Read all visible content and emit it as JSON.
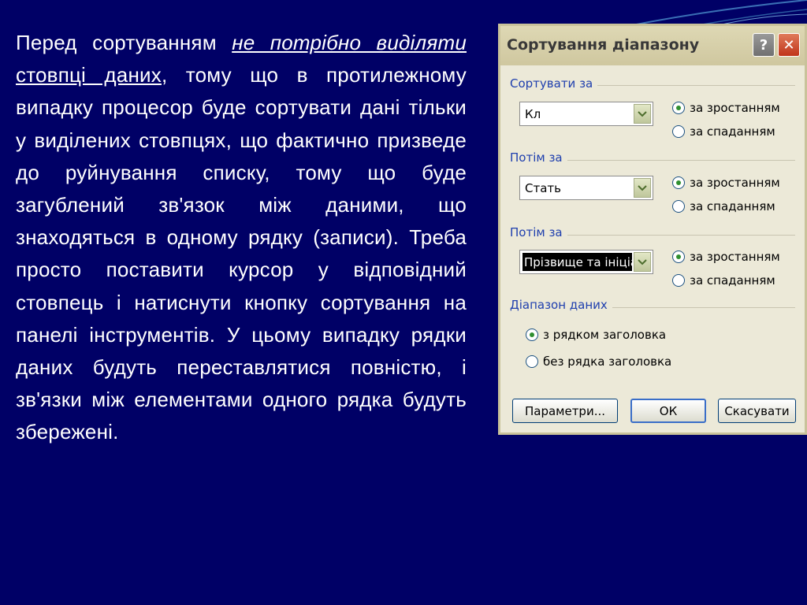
{
  "slide": {
    "text_plain_1": "Перед сортуванням ",
    "text_em": "не потрібно виділяти ",
    "text_ul": "стовпці даних",
    "text_plain_2": ", тому що в протилежному випадку процесор буде сортувати дані тільки у виділених стовпцях, що фактично призведе до руйнування списку, тому що буде загублений зв'язок між даними, що знаходяться в одному рядку (записи). Треба просто поставити курсор у відповідний стовпець і натиснути кнопку сортування на панелі інструментів. У цьому випадку рядки даних будуть переставлятися повністю, і зв'язки між елементами одного рядка будуть збережені."
  },
  "dialog": {
    "title": "Сортування діапазону",
    "help_glyph": "?",
    "close_glyph": "✕",
    "groups": [
      {
        "label": "Сортувати за",
        "value": "Кл",
        "ascending": "за зростанням",
        "descending": "за спаданням",
        "selected": "ascending"
      },
      {
        "label": "Потім за",
        "value": "Стать",
        "ascending": "за зростанням",
        "descending": "за спаданням",
        "selected": "ascending"
      },
      {
        "label": "Потім за",
        "value": "Прізвище та ініціал",
        "ascending": "за зростанням",
        "descending": "за спаданням",
        "selected": "ascending"
      }
    ],
    "range": {
      "label": "Діапазон даних",
      "with_header": "з рядком заголовка",
      "without_header": "без рядка заголовка",
      "selected": "with_header"
    },
    "buttons": {
      "params": "Параметри...",
      "ok": "ОК",
      "cancel": "Скасувати"
    }
  },
  "colors": {
    "background": "#000066",
    "dialog_bg": "#ece9d8",
    "group_label": "#1f3fae"
  }
}
